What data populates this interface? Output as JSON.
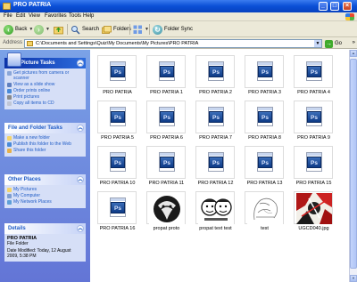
{
  "window": {
    "title": "PRO PATRIA"
  },
  "menu": [
    "File",
    "Edit",
    "View",
    "Favorites",
    "Tools",
    "Help"
  ],
  "toolbar": {
    "back": "Back",
    "search": "Search",
    "folders": "Folders",
    "sync": "Folder Sync"
  },
  "address": {
    "label": "Address",
    "path": "C:\\Documents and Settings\\Quiz\\My Documents\\My Pictures\\PRO PATRIA",
    "go": "Go",
    "links": "»"
  },
  "picture_tasks": {
    "title": "Picture Tasks",
    "items": [
      "Get pictures from camera or scanner",
      "View as a slide show",
      "Order prints online",
      "Print pictures",
      "Copy all items to CD"
    ]
  },
  "file_tasks": {
    "title": "File and Folder Tasks",
    "items": [
      "Make a new folder",
      "Publish this folder to the Web",
      "Share this folder"
    ]
  },
  "other_places": {
    "title": "Other Places",
    "items": [
      "My Pictures",
      "My Computer",
      "My Network Places"
    ]
  },
  "details": {
    "title": "Details",
    "name": "PRO PATRIA",
    "type": "File Folder",
    "modified": "Date Modified: Today, 12 August 2009, 5:38 PM"
  },
  "files": [
    {
      "name": "PRO PATRIA",
      "kind": "psd"
    },
    {
      "name": "PRO PATRIA 1",
      "kind": "psd"
    },
    {
      "name": "PRO PATRIA 2",
      "kind": "psd"
    },
    {
      "name": "PRO PATRIA 3",
      "kind": "psd"
    },
    {
      "name": "PRO PATRIA 4",
      "kind": "psd"
    },
    {
      "name": "PRO PATRIA 5",
      "kind": "psd"
    },
    {
      "name": "PRO PATRIA 6",
      "kind": "psd"
    },
    {
      "name": "PRO PATRIA 7",
      "kind": "psd"
    },
    {
      "name": "PRO PATRIA 8",
      "kind": "psd"
    },
    {
      "name": "PRO PATRIA 9",
      "kind": "psd"
    },
    {
      "name": "PRO PATRIA 10",
      "kind": "psd"
    },
    {
      "name": "PRO PATRIA 11",
      "kind": "psd"
    },
    {
      "name": "PRO PATRIA 12",
      "kind": "psd"
    },
    {
      "name": "PRO PATRIA 13",
      "kind": "psd"
    },
    {
      "name": "PRO PATRIA 15",
      "kind": "psd"
    },
    {
      "name": "PRO PATRIA 16",
      "kind": "psd"
    },
    {
      "name": "propat proto",
      "kind": "img-dark"
    },
    {
      "name": "propat text test",
      "kind": "img-faces"
    },
    {
      "name": "test",
      "kind": "img-sketch"
    },
    {
      "name": "UGCD040.jpg",
      "kind": "img-red"
    }
  ]
}
